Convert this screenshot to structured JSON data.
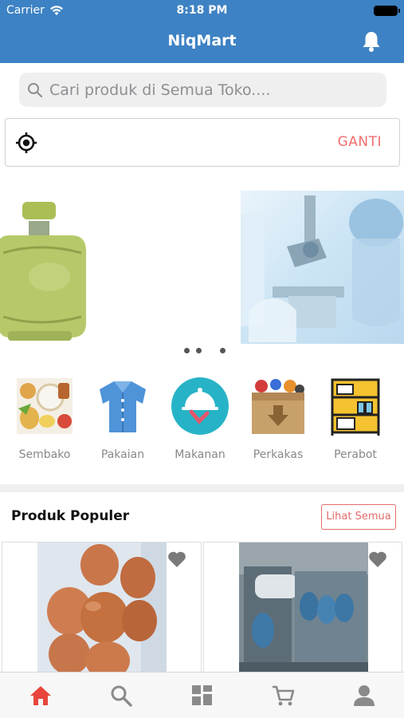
{
  "status_bar": {
    "carrier": "Carrier",
    "time": "8:18 PM"
  },
  "header": {
    "title": "NiqMart",
    "bell_icon": "bell-icon"
  },
  "search": {
    "placeholder": "Cari produk di Semua Toko...."
  },
  "location": {
    "icon": "locate-target-icon",
    "action_label": "GANTI"
  },
  "banner": {
    "slides": 3,
    "active_slide": 3
  },
  "categories": [
    {
      "label": "Sembako",
      "icon": "groceries-icon"
    },
    {
      "label": "Pakaian",
      "icon": "shirt-icon"
    },
    {
      "label": "Makanan",
      "icon": "food-cloche-icon"
    },
    {
      "label": "Perkakas",
      "icon": "tools-box-icon"
    },
    {
      "label": "Perabot",
      "icon": "shelf-icon"
    }
  ],
  "popular": {
    "title": "Produk Populer",
    "see_all_label": "Lihat Semua",
    "products": [
      {
        "image": "eggs-photo",
        "favorite_icon": "heart-icon"
      },
      {
        "image": "water-gallon-store-photo",
        "favorite_icon": "heart-icon"
      }
    ]
  },
  "tab_bar": {
    "items": [
      "home-icon",
      "search-icon",
      "categories-grid-icon",
      "cart-icon",
      "profile-icon"
    ],
    "active": "home-icon",
    "active_color": "#e8453c",
    "inactive_color": "#8a8a8a"
  },
  "colors": {
    "header_blue": "#3d82c4",
    "accent_red": "#f26d6d"
  }
}
